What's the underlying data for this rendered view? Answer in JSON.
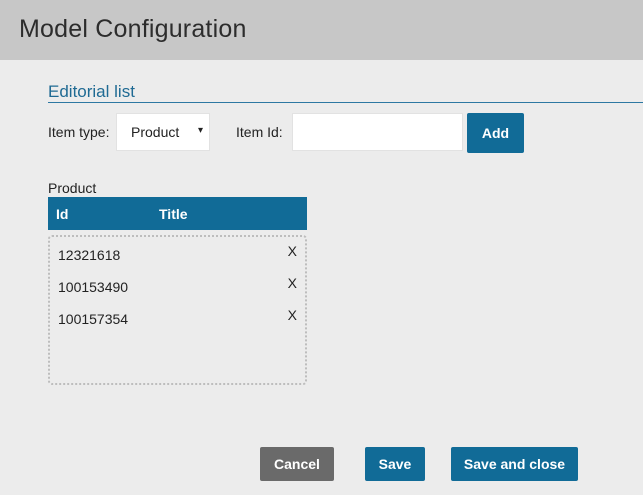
{
  "header": {
    "title": "Model Configuration"
  },
  "section": {
    "title": "Editorial list"
  },
  "form": {
    "item_type_label": "Item type:",
    "item_type_value": "Product",
    "caret": "▾",
    "item_id_label": "Item Id:",
    "item_id_value": "",
    "add_label": "Add"
  },
  "table": {
    "caption": "Product",
    "columns": [
      "Id",
      "Title"
    ],
    "rows": [
      {
        "id": "12321618",
        "remove": "X"
      },
      {
        "id": "100153490",
        "remove": "X"
      },
      {
        "id": "100157354",
        "remove": "X"
      }
    ]
  },
  "footer": {
    "cancel_label": "Cancel",
    "save_label": "Save",
    "save_close_label": "Save and close"
  },
  "colors": {
    "accent": "#116b97",
    "header_bg": "#c7c7c7",
    "body_bg": "#ececec",
    "cancel_bg": "#6a6a6a"
  }
}
